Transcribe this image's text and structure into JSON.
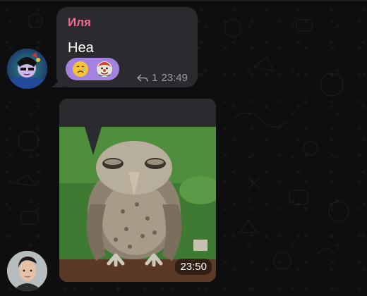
{
  "chat": {
    "message1": {
      "sender": "Иля",
      "text": "Неа",
      "reactions": [
        {
          "icon": "crying-face-emoji"
        },
        {
          "icon": "clown-sticker-emoji"
        }
      ],
      "reply_count": "1",
      "time": "23:49"
    },
    "message2": {
      "media": "owl-meme-photo",
      "time": "23:50"
    }
  },
  "colors": {
    "background": "#0e0e10",
    "bubble": "#2b2b2f",
    "sender_name": "#f06a8e",
    "reaction_pill": "#a483e0",
    "meta_text": "#9a9aa0"
  }
}
